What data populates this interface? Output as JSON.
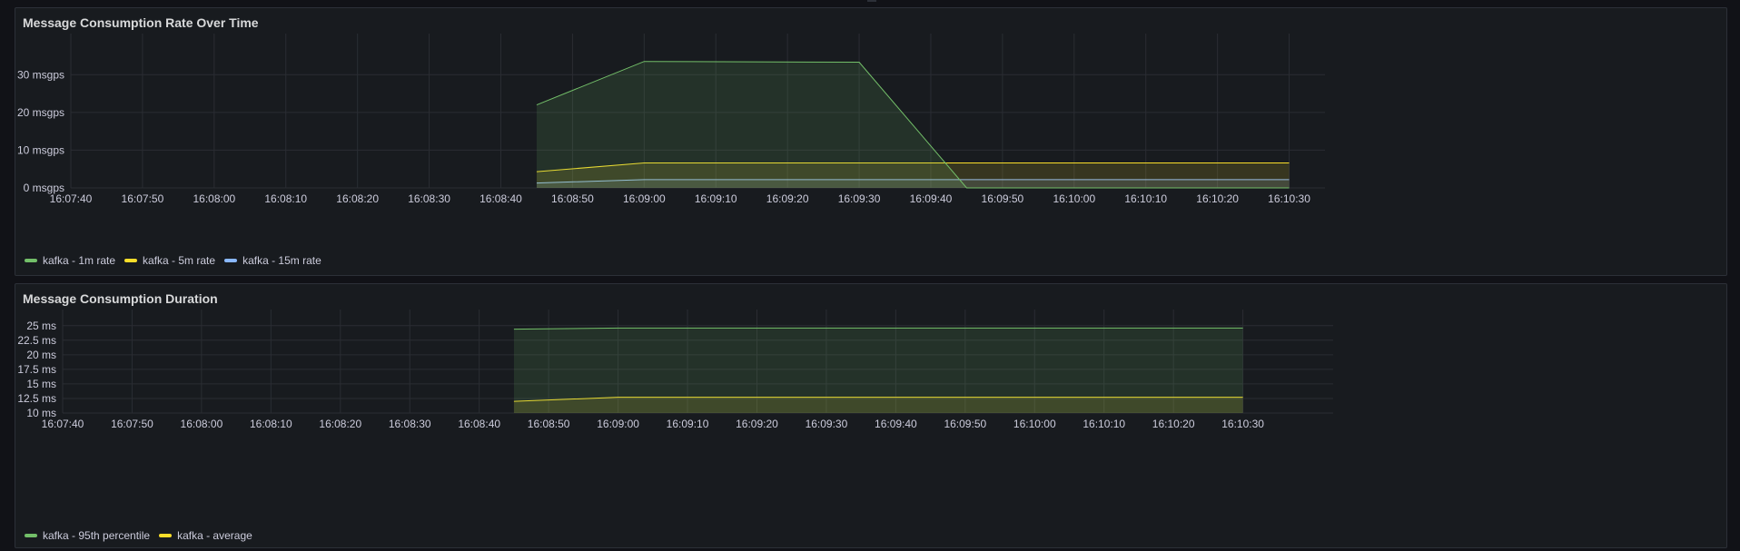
{
  "chart_data": [
    {
      "type": "line",
      "title": "Message Consumption Rate Over Time",
      "y_unit": " msgps",
      "ylim": [
        0,
        38
      ],
      "yticks": [
        0,
        10,
        20,
        30
      ],
      "xlim": [
        "16:07:40",
        "16:10:35"
      ],
      "x_tick_labels": [
        "16:07:40",
        "16:07:50",
        "16:08:00",
        "16:08:10",
        "16:08:20",
        "16:08:30",
        "16:08:40",
        "16:08:50",
        "16:09:00",
        "16:09:10",
        "16:09:20",
        "16:09:30",
        "16:09:40",
        "16:09:50",
        "16:10:00",
        "16:10:10",
        "16:10:20",
        "16:10:30"
      ],
      "grid": true,
      "legend_position": "bottom-left",
      "series": [
        {
          "name": "kafka - 1m rate",
          "color": "#73bf69",
          "x": [
            "16:08:45",
            "16:09:00",
            "16:09:30",
            "16:09:45",
            "16:10:30"
          ],
          "y": [
            22,
            33.5,
            33.3,
            0,
            0
          ]
        },
        {
          "name": "kafka - 5m rate",
          "color": "#fade2a",
          "x": [
            "16:08:45",
            "16:09:00",
            "16:09:30",
            "16:09:45",
            "16:10:30"
          ],
          "y": [
            4.3,
            6.6,
            6.6,
            6.6,
            6.6
          ]
        },
        {
          "name": "kafka - 15m rate",
          "color": "#8ab8ff",
          "x": [
            "16:08:45",
            "16:09:00",
            "16:09:30",
            "16:09:45",
            "16:10:30"
          ],
          "y": [
            1.3,
            2.2,
            2.2,
            2.2,
            2.2
          ]
        }
      ]
    },
    {
      "type": "line",
      "title": "Message Consumption Duration",
      "y_unit": " ms",
      "ylim": [
        10,
        25.9
      ],
      "yticks": [
        10,
        12.5,
        15,
        17.5,
        20,
        22.5,
        25
      ],
      "xlim": [
        "16:07:40",
        "16:10:43"
      ],
      "x_tick_labels": [
        "16:07:40",
        "16:07:50",
        "16:08:00",
        "16:08:10",
        "16:08:20",
        "16:08:30",
        "16:08:40",
        "16:08:50",
        "16:09:00",
        "16:09:10",
        "16:09:20",
        "16:09:30",
        "16:09:40",
        "16:09:50",
        "16:10:00",
        "16:10:10",
        "16:10:20",
        "16:10:30"
      ],
      "grid": true,
      "legend_position": "bottom-left",
      "series": [
        {
          "name": "kafka - 95th percentile",
          "color": "#73bf69",
          "x": [
            "16:08:45",
            "16:09:00",
            "16:10:30"
          ],
          "y": [
            24.4,
            24.6,
            24.6
          ]
        },
        {
          "name": "kafka - average",
          "color": "#fade2a",
          "x": [
            "16:08:45",
            "16:09:00",
            "16:10:30"
          ],
          "y": [
            12.0,
            12.7,
            12.7
          ]
        }
      ]
    }
  ]
}
